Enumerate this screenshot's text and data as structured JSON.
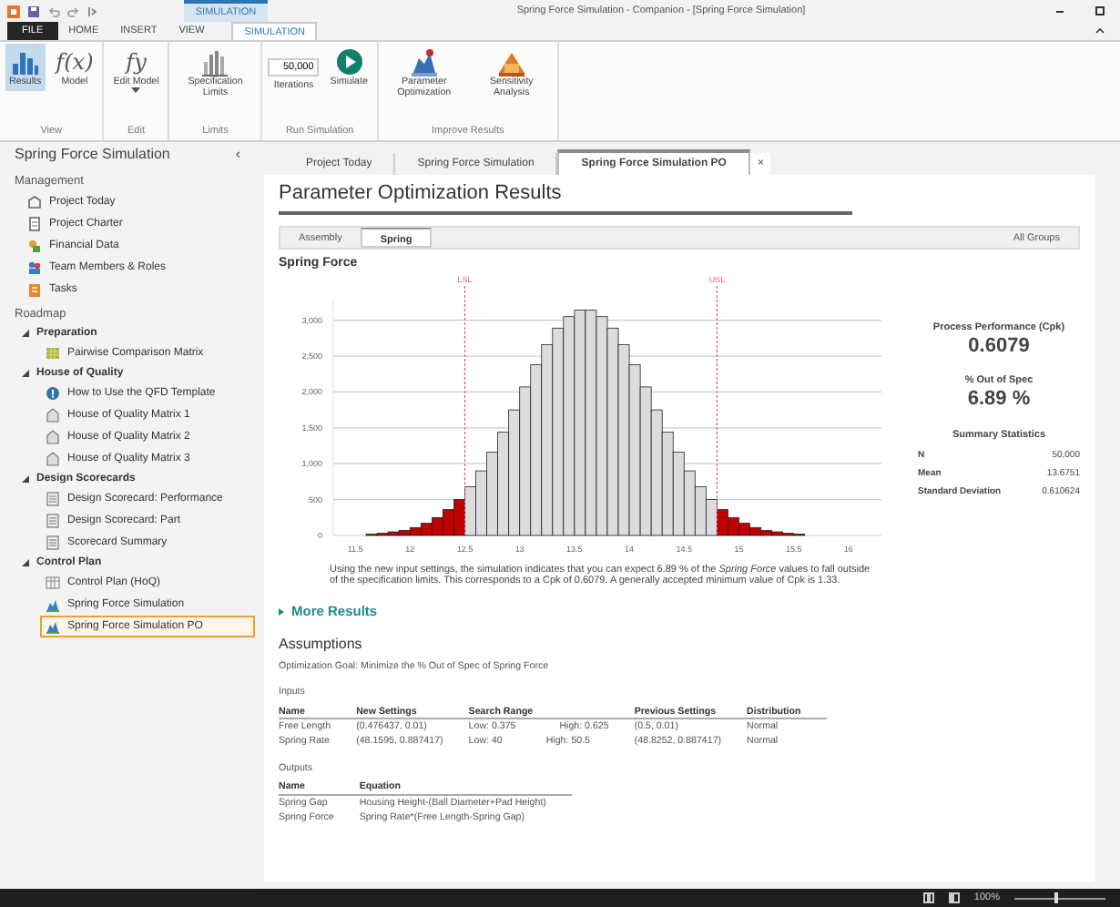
{
  "window": {
    "title": "Spring Force Simulation - Companion - [Spring Force Simulation]",
    "context_tab": "SIMULATION"
  },
  "ribbon_tabs": [
    {
      "label": "FILE",
      "kind": "file",
      "selected": false
    },
    {
      "label": "HOME",
      "kind": "tab",
      "selected": false
    },
    {
      "label": "INSERT",
      "kind": "tab",
      "selected": false
    },
    {
      "label": "VIEW",
      "kind": "tab",
      "selected": false
    },
    {
      "label": "SIMULATION",
      "kind": "tab",
      "selected": true
    }
  ],
  "ribbon_groups": [
    {
      "label": "View",
      "controls": [
        {
          "kind": "button",
          "label": "Results",
          "selected": true
        },
        {
          "kind": "button",
          "label": "Model",
          "glyph": "f(x)",
          "selected": false
        }
      ]
    },
    {
      "label": "Edit",
      "controls": [
        {
          "kind": "button",
          "label": "Edit Model",
          "glyph": "fy",
          "dropdown": true,
          "selected": false
        }
      ]
    },
    {
      "label": "Limits",
      "controls": [
        {
          "kind": "button",
          "label": "Specification Limits",
          "selected": false
        }
      ]
    },
    {
      "label": "Run Simulation",
      "controls": [
        {
          "kind": "field",
          "value": "50,000",
          "label": "Iterations"
        },
        {
          "kind": "button",
          "label": "Simulate",
          "selected": false
        }
      ]
    },
    {
      "label": "Improve Results",
      "controls": [
        {
          "kind": "button",
          "label": "Parameter Optimization",
          "selected": false
        },
        {
          "kind": "button",
          "label": "Sensitivity Analysis",
          "selected": false
        }
      ]
    }
  ],
  "sidebar": {
    "title": "Spring Force Simulation",
    "collapse": "‹",
    "sections": [
      {
        "heading": "Management",
        "items": [
          {
            "label": "Project Today",
            "kind": "page",
            "selected": false
          },
          {
            "label": "Project Charter",
            "kind": "charter",
            "selected": false
          },
          {
            "label": "Financial Data",
            "kind": "finance",
            "selected": false
          },
          {
            "label": "Team Members & Roles",
            "kind": "team",
            "selected": false
          },
          {
            "label": "Tasks",
            "kind": "tasks",
            "selected": false
          }
        ]
      },
      {
        "heading": "Roadmap",
        "items": [
          {
            "label": "Preparation",
            "expanded": true,
            "children": [
              {
                "label": "Pairwise Comparison Matrix",
                "kind": "matrix",
                "selected": false
              }
            ]
          },
          {
            "label": "House of Quality",
            "expanded": true,
            "children": [
              {
                "label": "How to Use the QFD Template",
                "kind": "help",
                "selected": false
              },
              {
                "label": "House of Quality Matrix 1",
                "kind": "house",
                "selected": false
              },
              {
                "label": "House of Quality Matrix 2",
                "kind": "house",
                "selected": false
              },
              {
                "label": "House of Quality Matrix 3",
                "kind": "house",
                "selected": false
              }
            ]
          },
          {
            "label": "Design Scorecards",
            "expanded": true,
            "children": [
              {
                "label": "Design Scorecard: Performance",
                "kind": "scorecard",
                "selected": false
              },
              {
                "label": "Design Scorecard: Part",
                "kind": "scorecard",
                "selected": false
              },
              {
                "label": "Scorecard Summary",
                "kind": "scorecard",
                "selected": false
              }
            ]
          },
          {
            "label": "Control Plan",
            "expanded": true,
            "children": [
              {
                "label": "Control Plan (HoQ)",
                "kind": "plan",
                "selected": false
              },
              {
                "label": "Spring Force Simulation",
                "kind": "simulation",
                "selected": false
              },
              {
                "label": "Spring Force Simulation PO",
                "kind": "simulation",
                "selected": true
              }
            ]
          }
        ]
      }
    ]
  },
  "doc_tabs": [
    {
      "label": "Project Today",
      "selected": false
    },
    {
      "label": "Spring Force Simulation",
      "selected": false
    },
    {
      "label": "Spring Force Simulation PO",
      "selected": true,
      "close": "×"
    }
  ],
  "results": {
    "title": "Parameter Optimization Results",
    "group_tabs": [
      {
        "label": "Assembly",
        "selected": false
      },
      {
        "label": "Spring",
        "selected": true
      }
    ],
    "all_groups": "All Groups",
    "chart_data": {
      "type": "bar",
      "title": "Spring Force",
      "x": [
        11.65,
        11.75,
        11.85,
        11.95,
        12.05,
        12.15,
        12.25,
        12.35,
        12.45,
        12.55,
        12.65,
        12.75,
        12.85,
        12.95,
        13.05,
        13.15,
        13.25,
        13.35,
        13.45,
        13.55,
        13.65,
        13.75,
        13.85,
        13.95,
        14.05,
        14.15,
        14.25,
        14.35,
        14.45,
        14.55,
        14.65,
        14.75,
        14.85,
        14.95,
        15.05,
        15.15,
        15.25,
        15.35,
        15.45,
        15.55
      ],
      "values": [
        20,
        30,
        50,
        70,
        110,
        170,
        250,
        360,
        500,
        680,
        900,
        1160,
        1440,
        1750,
        2070,
        2380,
        2660,
        2890,
        3050,
        3140,
        3140,
        3050,
        2890,
        2660,
        2380,
        2070,
        1750,
        1440,
        1160,
        900,
        680,
        500,
        360,
        250,
        170,
        110,
        70,
        50,
        30,
        20
      ],
      "xlim": [
        11.3,
        16.3
      ],
      "ylim": [
        0,
        3300
      ],
      "grid": true,
      "xticks": [
        {
          "value": 11.5,
          "label": "11.5"
        },
        {
          "value": 12,
          "label": "12"
        },
        {
          "value": 12.5,
          "label": "12.5"
        },
        {
          "value": 13,
          "label": "13"
        },
        {
          "value": 13.5,
          "label": "13.5"
        },
        {
          "value": 14,
          "label": "14"
        },
        {
          "value": 14.5,
          "label": "14.5"
        },
        {
          "value": 15,
          "label": "15"
        },
        {
          "value": 15.5,
          "label": "15.5"
        },
        {
          "value": 16,
          "label": "16"
        }
      ],
      "yticks": [
        {
          "value": 0,
          "label": "0"
        },
        {
          "value": 500,
          "label": "500"
        },
        {
          "value": 1000,
          "label": "1,000"
        },
        {
          "value": 1500,
          "label": "1,500"
        },
        {
          "value": 2000,
          "label": "2,000"
        },
        {
          "value": 2500,
          "label": "2,500"
        },
        {
          "value": 3000,
          "label": "3,000"
        }
      ],
      "ref_lines": [
        {
          "axis": "x",
          "value": 12.5,
          "label": "LSL"
        },
        {
          "axis": "x",
          "value": 14.8,
          "label": "USL"
        }
      ]
    },
    "description": "Using the new input settings, the simulation indicates that you can expect 6.89 % of the *Spring Force* values to fall outside of the specification limits. This corresponds to a Cpk of 0.6079. A generally accepted minimum value of Cpk is 1.33.",
    "metrics": [
      {
        "label": "Process Performance (Cpk)",
        "value": "0.6079"
      },
      {
        "label": "% Out of Spec",
        "value": "6.89 %"
      }
    ],
    "summary": {
      "title": "Summary Statistics",
      "rows": [
        {
          "label": "N",
          "value": "50,000"
        },
        {
          "label": "Mean",
          "value": "13.6751"
        },
        {
          "label": "Standard Deviation",
          "value": "0.610624"
        }
      ]
    },
    "more_results": "More Results",
    "assumptions": {
      "title": "Assumptions",
      "goal": "Optimization Goal: Minimize the % Out of Spec of Spring Force",
      "inputs": {
        "title": "Inputs",
        "columns": [
          {
            "label": "Name"
          },
          {
            "label": "New Settings"
          },
          {
            "label": "Search Range"
          },
          {
            "label": "Previous Settings"
          },
          {
            "label": "Distribution"
          }
        ],
        "rows": [
          [
            "Free Length",
            "(0.476437, 0.01)",
            [
              "Low: 0.375",
              "High: 0.625"
            ],
            "(0.5, 0.01)",
            "Normal"
          ],
          [
            "Spring Rate",
            "(48.1595, 0.887417)",
            [
              "Low: 40",
              "High: 50.5"
            ],
            "(48.8252, 0.887417)",
            "Normal"
          ]
        ]
      },
      "outputs": {
        "title": "Outputs",
        "columns": [
          {
            "label": "Name"
          },
          {
            "label": "Equation"
          }
        ],
        "rows": [
          [
            "Spring Gap",
            "Housing Height-(Ball Diameter+Pad Height)"
          ],
          [
            "Spring Force",
            "Spring Rate*(Free Length-Spring Gap)"
          ]
        ]
      }
    }
  },
  "status_bar": {
    "zoom": "100%",
    "zoom_level": {
      "level": 0.45
    }
  }
}
